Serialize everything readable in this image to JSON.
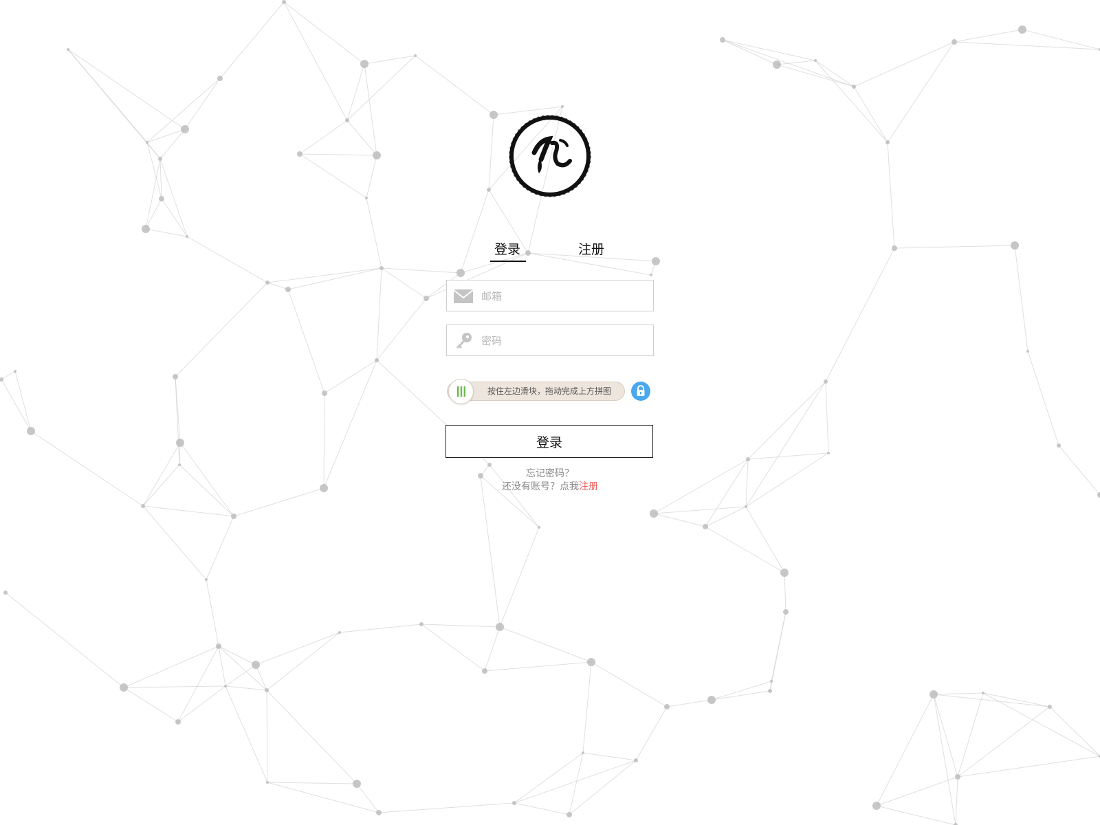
{
  "tabs": {
    "login": "登录",
    "register": "注册",
    "active": "login"
  },
  "form": {
    "email_placeholder": "邮箱",
    "email_value": "",
    "password_placeholder": "密码",
    "password_value": ""
  },
  "captcha": {
    "text": "按住左边滑块，拖动完成上方拼图",
    "progress": 0
  },
  "actions": {
    "login_button": "登录"
  },
  "links": {
    "forgot_password": "忘记密码？",
    "no_account_prefix": "还没有账号？点我",
    "register_link": "注册"
  },
  "icons": {
    "email": "envelope-icon",
    "password": "key-icon",
    "slider_knob": "grip-bars-icon",
    "lock": "lock-icon",
    "logo": "brush-circle-logo"
  },
  "colors": {
    "accent_link": "#f06060",
    "lock_blue": "#4aa8ef",
    "grip_green": "#6cba4e",
    "slider_track": "#eee5dd"
  }
}
